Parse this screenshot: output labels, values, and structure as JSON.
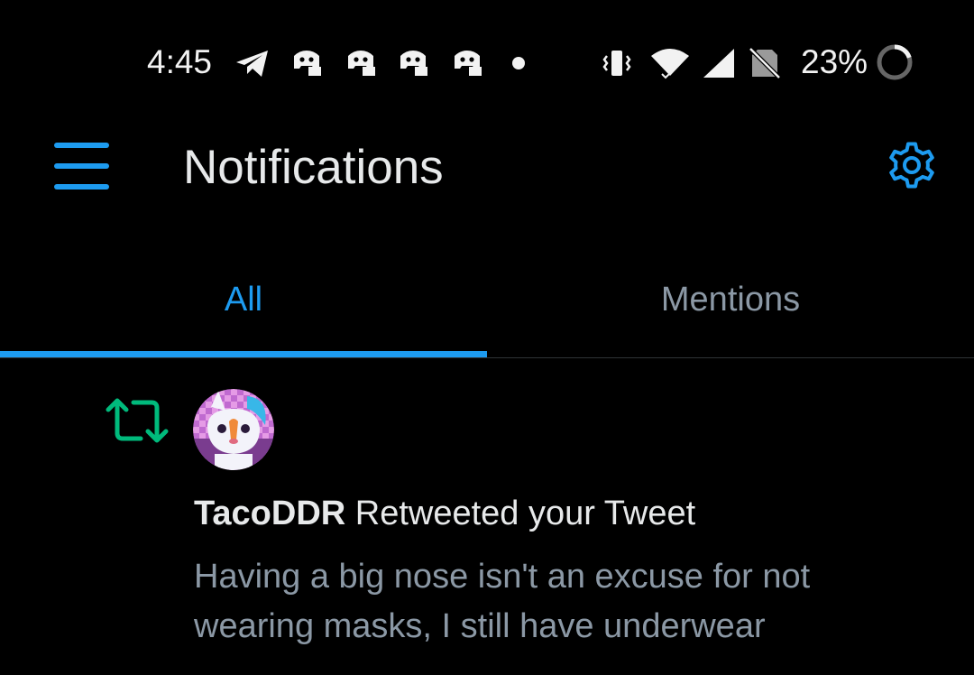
{
  "status_bar": {
    "time": "4:45",
    "notification_icons": [
      "telegram-icon",
      "discord-icon",
      "discord-icon",
      "discord-icon",
      "discord-icon"
    ],
    "system_icons": [
      "vibrate-icon",
      "wifi-icon",
      "signal-icon",
      "no-sim-icon"
    ],
    "battery_percent": "23%"
  },
  "header": {
    "title": "Notifications",
    "menu_icon": "menu-icon",
    "settings_icon": "gear-icon"
  },
  "tabs": [
    {
      "label": "All",
      "selected": true
    },
    {
      "label": "Mentions",
      "selected": false
    }
  ],
  "notifications": [
    {
      "type_icon": "retweet-icon",
      "user": "TacoDDR",
      "action": " Retweeted your Tweet",
      "tweet_text": "Having a big nose isn't an excuse for not wearing masks, I still have underwear"
    }
  ],
  "colors": {
    "accent": "#1d9bf0",
    "retweet": "#00ba7c",
    "background": "#000000",
    "muted": "#8b98a5"
  }
}
